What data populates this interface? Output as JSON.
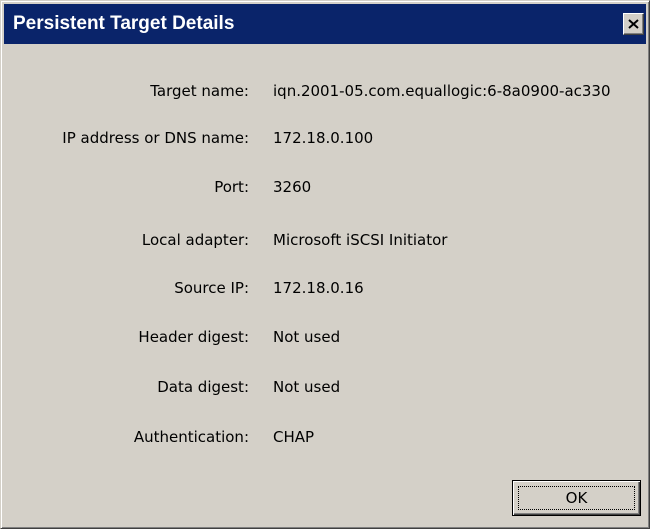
{
  "window": {
    "title": "Persistent Target Details",
    "close_icon": "close-icon"
  },
  "details": [
    {
      "label": "Target name:",
      "value": "iqn.2001-05.com.equallogic:6-8a0900-ac330"
    },
    {
      "label": "IP address or DNS name:",
      "value": "172.18.0.100"
    },
    {
      "label": "Port:",
      "value": "3260"
    },
    {
      "label": "Local adapter:",
      "value": "Microsoft iSCSI Initiator"
    },
    {
      "label": "Source IP:",
      "value": "172.18.0.16"
    },
    {
      "label": "Header digest:",
      "value": "Not used"
    },
    {
      "label": "Data digest:",
      "value": "Not used"
    },
    {
      "label": "Authentication:",
      "value": "CHAP"
    }
  ],
  "buttons": {
    "ok_label": "OK"
  }
}
